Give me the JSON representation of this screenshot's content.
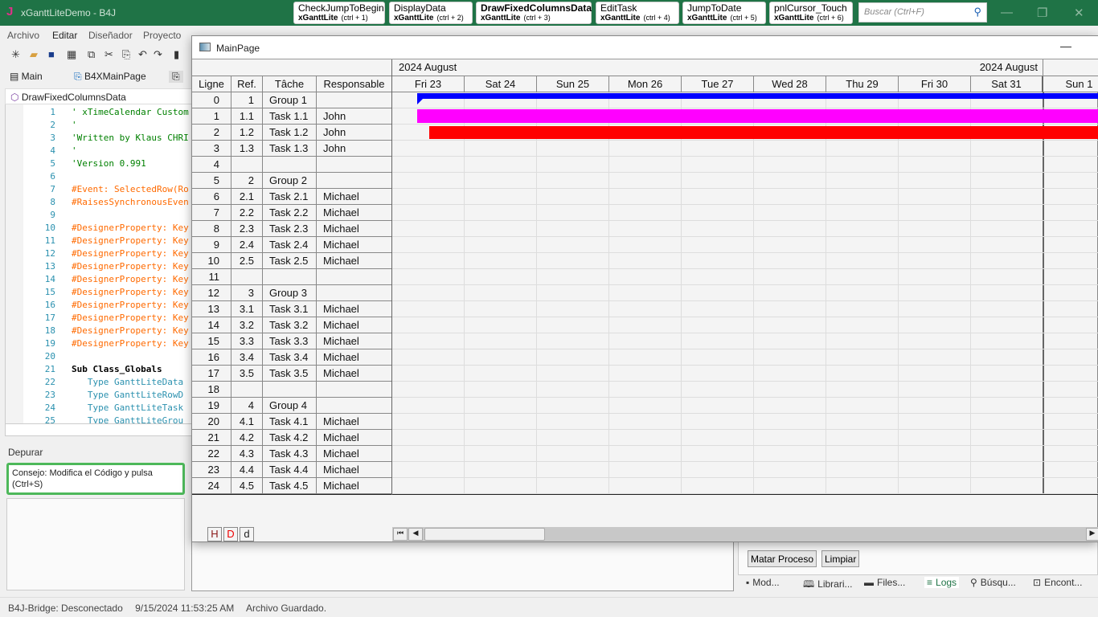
{
  "app": {
    "title": "xGanttLiteDemo - B4J",
    "logo": "J"
  },
  "quick_buttons": [
    {
      "name": "CheckJumpToBegin",
      "lib": "xGanttLite",
      "shortcut": "(ctrl + 1)"
    },
    {
      "name": "DisplayData",
      "lib": "xGanttLite",
      "shortcut": "(ctrl + 2)"
    },
    {
      "name": "DrawFixedColumnsData",
      "lib": "xGanttLite",
      "shortcut": "(ctrl + 3)"
    },
    {
      "name": "EditTask",
      "lib": "xGanttLite",
      "shortcut": "(ctrl + 4)"
    },
    {
      "name": "JumpToDate",
      "lib": "xGanttLite",
      "shortcut": "(ctrl + 5)"
    },
    {
      "name": "pnlCursor_Touch",
      "lib": "xGanttLite",
      "shortcut": "(ctrl + 6)"
    }
  ],
  "search": {
    "placeholder": "Buscar (Ctrl+F)"
  },
  "menu": [
    "Archivo",
    "Editar",
    "Diseñador",
    "Proyecto"
  ],
  "tabs": [
    "Main",
    "B4XMainPage"
  ],
  "module_header": "DrawFixedColumnsData",
  "code": [
    {
      "n": "1",
      "t": "' xTimeCalendar Custom",
      "c": "#008000"
    },
    {
      "n": "2",
      "t": "'",
      "c": "#008000"
    },
    {
      "n": "3",
      "t": "'Written by Klaus CHRI",
      "c": "#008000"
    },
    {
      "n": "4",
      "t": "'",
      "c": "#008000"
    },
    {
      "n": "5",
      "t": "'Version 0.991",
      "c": "#008000"
    },
    {
      "n": "6",
      "t": "",
      "c": "#000"
    },
    {
      "n": "7",
      "t": "#Event: SelectedRow(Ro",
      "c": "#ff6a00"
    },
    {
      "n": "8",
      "t": "#RaisesSynchronousEven",
      "c": "#ff6a00"
    },
    {
      "n": "9",
      "t": "",
      "c": "#000"
    },
    {
      "n": "10",
      "t": "#DesignerProperty: Key",
      "c": "#ff6a00"
    },
    {
      "n": "11",
      "t": "#DesignerProperty: Key",
      "c": "#ff6a00"
    },
    {
      "n": "12",
      "t": "#DesignerProperty: Key",
      "c": "#ff6a00"
    },
    {
      "n": "13",
      "t": "#DesignerProperty: Key",
      "c": "#ff6a00"
    },
    {
      "n": "14",
      "t": "#DesignerProperty: Key",
      "c": "#ff6a00"
    },
    {
      "n": "15",
      "t": "#DesignerProperty: Key",
      "c": "#ff6a00"
    },
    {
      "n": "16",
      "t": "#DesignerProperty: Key",
      "c": "#ff6a00"
    },
    {
      "n": "17",
      "t": "#DesignerProperty: Key",
      "c": "#ff6a00"
    },
    {
      "n": "18",
      "t": "#DesignerProperty: Key",
      "c": "#ff6a00"
    },
    {
      "n": "19",
      "t": "#DesignerProperty: Key",
      "c": "#ff6a00"
    },
    {
      "n": "20",
      "t": "",
      "c": "#000"
    },
    {
      "n": "21",
      "t": "Sub Class_Globals",
      "c": "#000"
    },
    {
      "n": "22",
      "t": "   Type GanttLiteData",
      "c": "#2b91af"
    },
    {
      "n": "23",
      "t": "   Type GanttLiteRowD",
      "c": "#2b91af"
    },
    {
      "n": "24",
      "t": "   Type GanttLiteTask",
      "c": "#2b91af"
    },
    {
      "n": "25",
      "t": "   Type GanttLiteGrou",
      "c": "#2b91af"
    }
  ],
  "debug": {
    "label": "Depurar",
    "tip": "Consejo: Modifica el Código y pulsa (Ctrl+S)"
  },
  "status": {
    "bridge": "B4J-Bridge: Desconectado",
    "time": "9/15/2024 11:53:25 AM",
    "msg": "Archivo Guardado."
  },
  "panel_buttons": {
    "kill": "Matar Proceso",
    "clear": "Limpiar"
  },
  "bottom_tabs": [
    "Mod...",
    "Librari...",
    "Files...",
    "Logs",
    "Búsqu...",
    "Encont..."
  ],
  "mainpage": {
    "title": "MainPage",
    "month_left": "2024  August",
    "month_right": "2024  August",
    "columns": [
      "Ligne",
      "Ref.",
      "Tâche",
      "Responsable"
    ],
    "days": [
      "Fri  23",
      "Sat  24",
      "Sun  25",
      "Mon  26",
      "Tue  27",
      "Wed  28",
      "Thu  29",
      "Fri  30",
      "Sat  31",
      "Sun  1"
    ],
    "rows": [
      [
        "0",
        "1",
        "Group 1",
        ""
      ],
      [
        "1",
        "1.1",
        "Task 1.1",
        "John"
      ],
      [
        "2",
        "1.2",
        "Task 1.2",
        "John"
      ],
      [
        "3",
        "1.3",
        "Task 1.3",
        "John"
      ],
      [
        "4",
        "",
        "",
        ""
      ],
      [
        "5",
        "2",
        "Group 2",
        ""
      ],
      [
        "6",
        "2.1",
        "Task 2.1",
        "Michael"
      ],
      [
        "7",
        "2.2",
        "Task 2.2",
        "Michael"
      ],
      [
        "8",
        "2.3",
        "Task 2.3",
        "Michael"
      ],
      [
        "9",
        "2.4",
        "Task 2.4",
        "Michael"
      ],
      [
        "10",
        "2.5",
        "Task 2.5",
        "Michael"
      ],
      [
        "11",
        "",
        "",
        ""
      ],
      [
        "12",
        "3",
        "Group 3",
        ""
      ],
      [
        "13",
        "3.1",
        "Task 3.1",
        "Michael"
      ],
      [
        "14",
        "3.2",
        "Task 3.2",
        "Michael"
      ],
      [
        "15",
        "3.3",
        "Task 3.3",
        "Michael"
      ],
      [
        "16",
        "3.4",
        "Task 3.4",
        "Michael"
      ],
      [
        "17",
        "3.5",
        "Task 3.5",
        "Michael"
      ],
      [
        "18",
        "",
        "",
        ""
      ],
      [
        "19",
        "4",
        "Group 4",
        ""
      ],
      [
        "20",
        "4.1",
        "Task 4.1",
        "Michael"
      ],
      [
        "21",
        "4.2",
        "Task 4.2",
        "Michael"
      ],
      [
        "22",
        "4.3",
        "Task 4.3",
        "Michael"
      ],
      [
        "23",
        "4.4",
        "Task 4.4",
        "Michael"
      ],
      [
        "24",
        "4.5",
        "Task 4.5",
        "Michael"
      ]
    ],
    "bar_colors": {
      "group": "#0000ff",
      "task11": "#ff00ff",
      "task12": "#ff0000"
    },
    "zoom_buttons": [
      "H",
      "D",
      "d"
    ]
  }
}
